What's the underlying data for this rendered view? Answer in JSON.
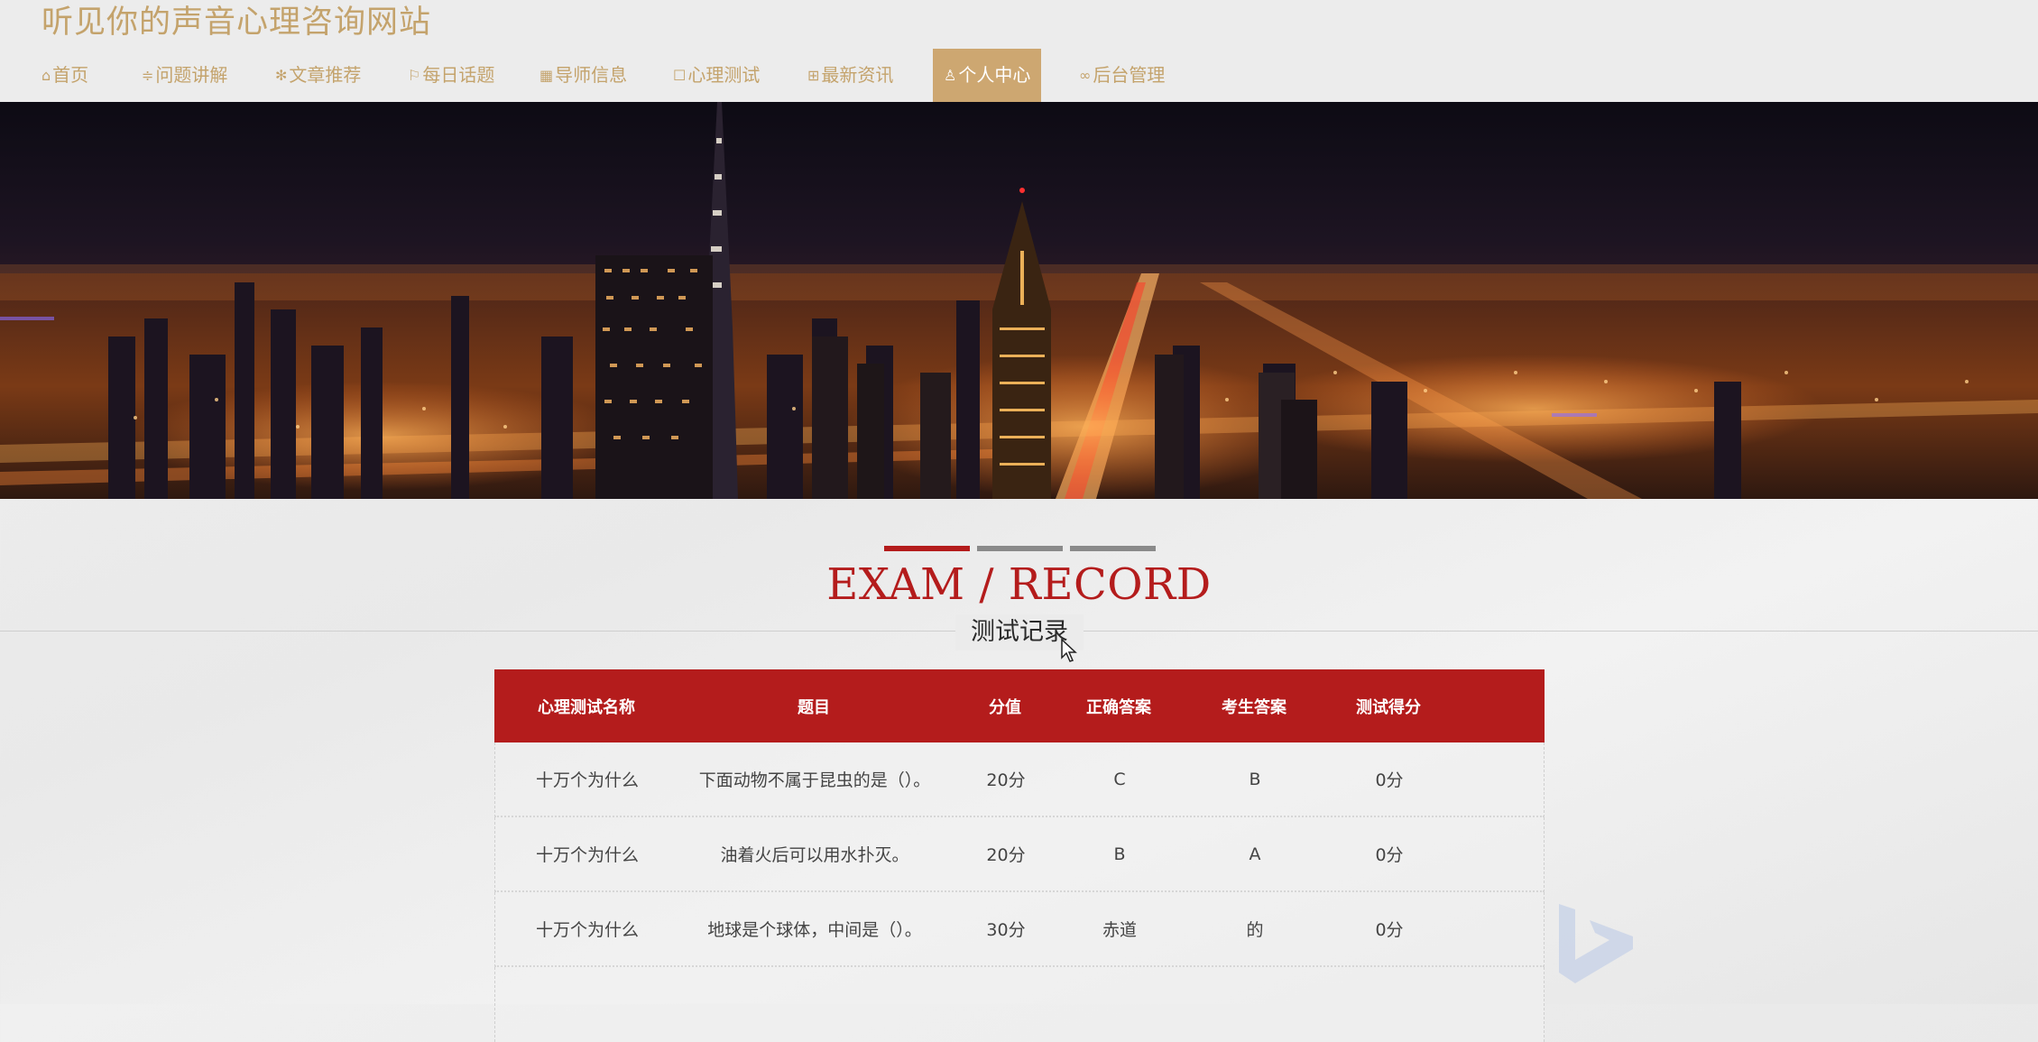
{
  "site": {
    "title": "听见你的声音心理咨询网站"
  },
  "nav": {
    "items": [
      {
        "icon": "home-icon",
        "glyph": "⌂",
        "label": "首页"
      },
      {
        "icon": "sliders-icon",
        "glyph": "≑",
        "label": "问题讲解"
      },
      {
        "icon": "snowflake-icon",
        "glyph": "✻",
        "label": "文章推荐"
      },
      {
        "icon": "flag-icon",
        "glyph": "⚐",
        "label": "每日话题"
      },
      {
        "icon": "grid-icon",
        "glyph": "▦",
        "label": "导师信息"
      },
      {
        "icon": "form-icon",
        "glyph": "☐",
        "label": "心理测试"
      },
      {
        "icon": "gift-icon",
        "glyph": "⊞",
        "label": "最新资讯"
      },
      {
        "icon": "user-icon",
        "glyph": "♙",
        "label": "个人中心",
        "active": true
      },
      {
        "icon": "link-icon",
        "glyph": "∞",
        "label": "后台管理"
      }
    ]
  },
  "section": {
    "title": "EXAM / RECORD",
    "subtitle": "测试记录",
    "active_tab": 0
  },
  "table": {
    "headers": [
      "心理测试名称",
      "题目",
      "分值",
      "正确答案",
      "考生答案",
      "测试得分"
    ],
    "rows": [
      [
        "十万个为什么",
        "下面动物不属于昆虫的是（）。",
        "20分",
        "C",
        "B",
        "0分"
      ],
      [
        "十万个为什么",
        "油着火后可以用水扑灭。",
        "20分",
        "B",
        "A",
        "0分"
      ],
      [
        "十万个为什么",
        "地球是个球体，中间是（）。",
        "30分",
        "赤道",
        "的",
        "0分"
      ]
    ]
  },
  "colors": {
    "brand_gold": "#c4a36c",
    "nav_active_bg": "#cda771",
    "accent_red": "#b41c1c"
  }
}
